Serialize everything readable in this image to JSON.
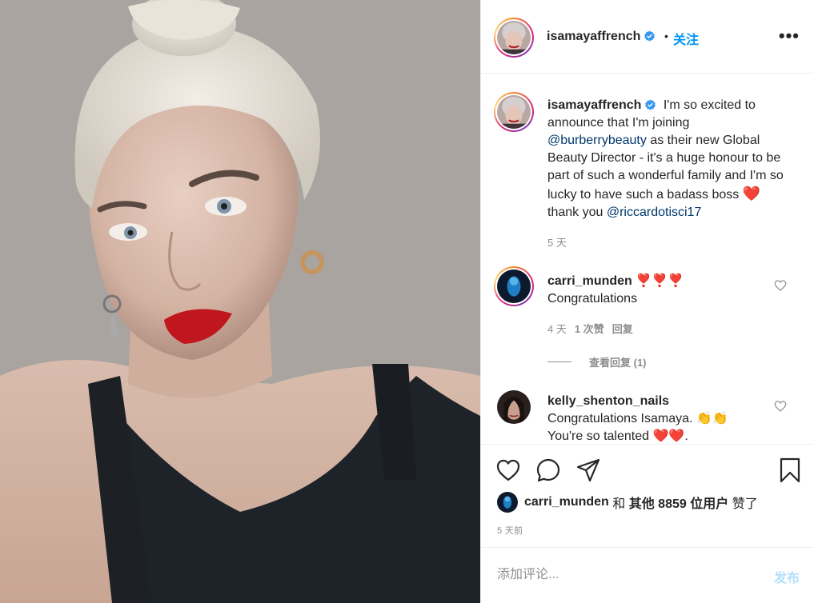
{
  "post": {
    "username": "isamayaffrench",
    "follow_label": "关注",
    "more_label": "•••",
    "separator": "•"
  },
  "caption": {
    "username": "isamayaffrench",
    "text_part1": "I'm so excited to announce that I'm joining",
    "mention1": "@burberrybeauty",
    "text_part2": "as their new Global Beauty Director - it's a huge honour to be part of such a wonderful family and I'm so lucky to have such a badass boss",
    "emoji": "❤️",
    "text_part3": "thank you",
    "mention2": "@riccardotisci17",
    "age": "5 天"
  },
  "comments": [
    {
      "username": "carri_munden",
      "emojis": "❣️❣️❣️",
      "text": "Congratulations",
      "age": "4 天",
      "likes": "1 次赞",
      "reply": "回复",
      "view_replies": "查看回复 (1)"
    },
    {
      "username": "kelly_shenton_nails",
      "line1": "Congratulations Isamaya.",
      "line1_emoji": "👏👏",
      "line2": "You're so talented",
      "line2_emoji": "❤️❤️",
      "line2_end": "."
    }
  ],
  "likes": {
    "liker": "carri_munden",
    "and": "和",
    "others": "其他 8859 位用户",
    "suffix": "赞了"
  },
  "post_age": "5 天前",
  "comment_box": {
    "placeholder": "添加评论...",
    "post_label": "发布"
  },
  "icons": [
    "verified-badge-icon",
    "more-icon",
    "heart-icon",
    "comment-icon",
    "share-icon",
    "bookmark-icon"
  ],
  "colors": {
    "link": "#00376b",
    "follow": "#0095f6",
    "verified": "#3897f0",
    "muted": "#8e8e8e",
    "post_disabled": "#b2dffc"
  }
}
